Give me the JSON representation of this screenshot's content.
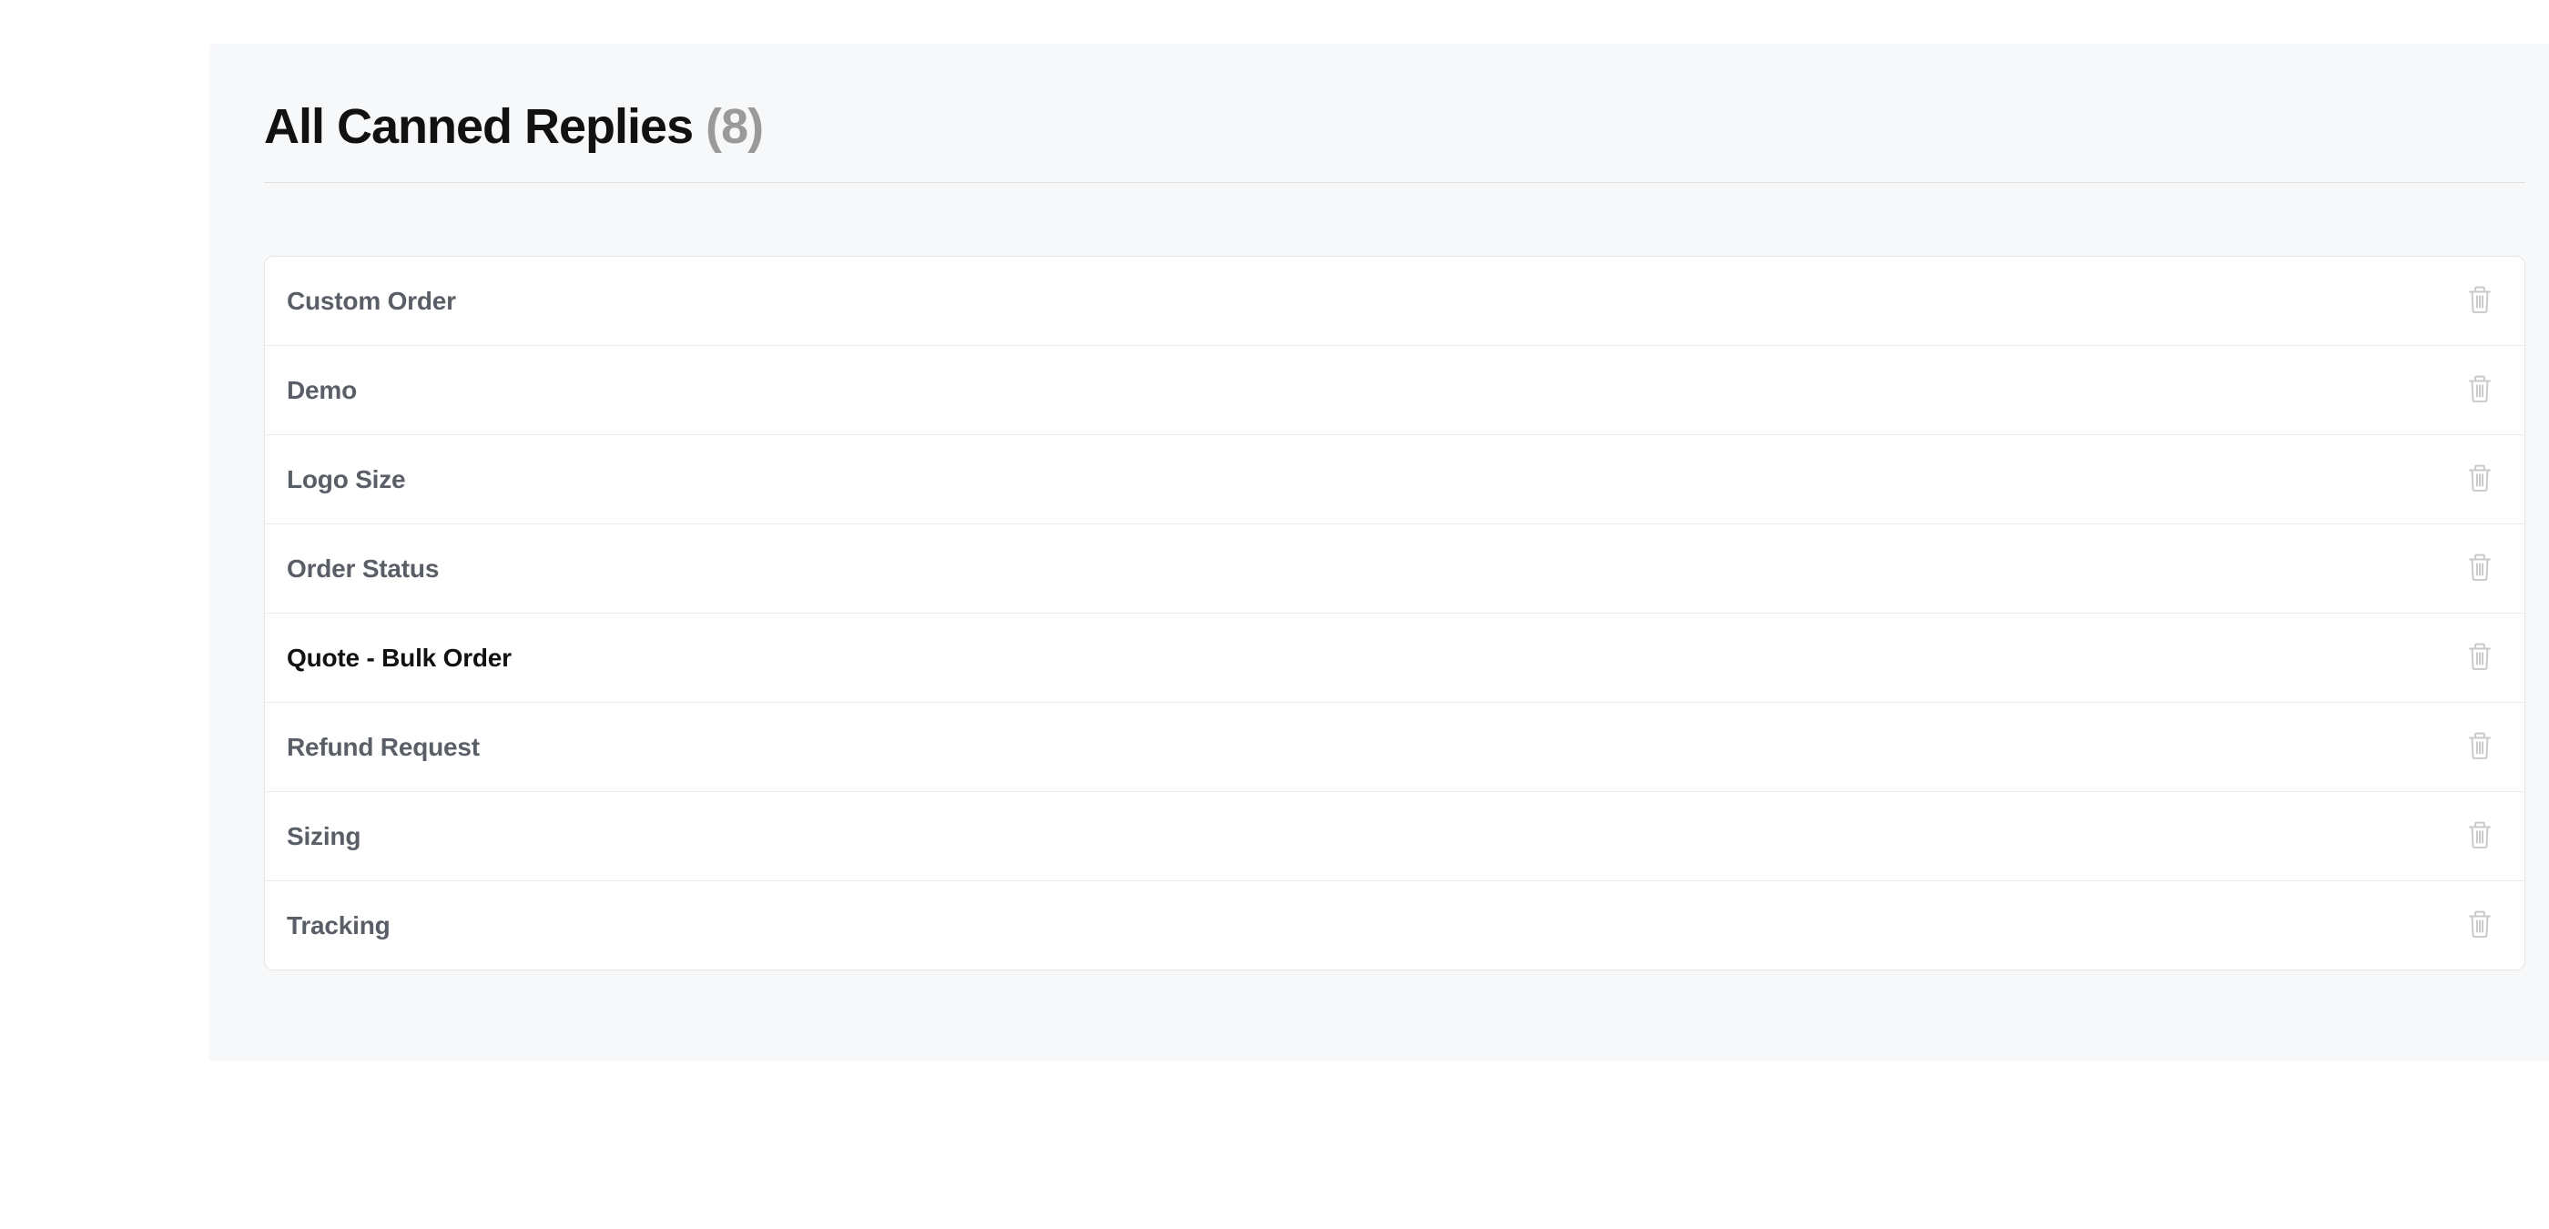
{
  "header": {
    "title": "All Canned Replies",
    "count": "(8)"
  },
  "replies": [
    {
      "label": "Custom Order",
      "active": false
    },
    {
      "label": "Demo",
      "active": false
    },
    {
      "label": "Logo Size",
      "active": false
    },
    {
      "label": "Order Status",
      "active": false
    },
    {
      "label": "Quote - Bulk Order",
      "active": true
    },
    {
      "label": "Refund Request",
      "active": false
    },
    {
      "label": "Sizing",
      "active": false
    },
    {
      "label": "Tracking",
      "active": false
    }
  ]
}
